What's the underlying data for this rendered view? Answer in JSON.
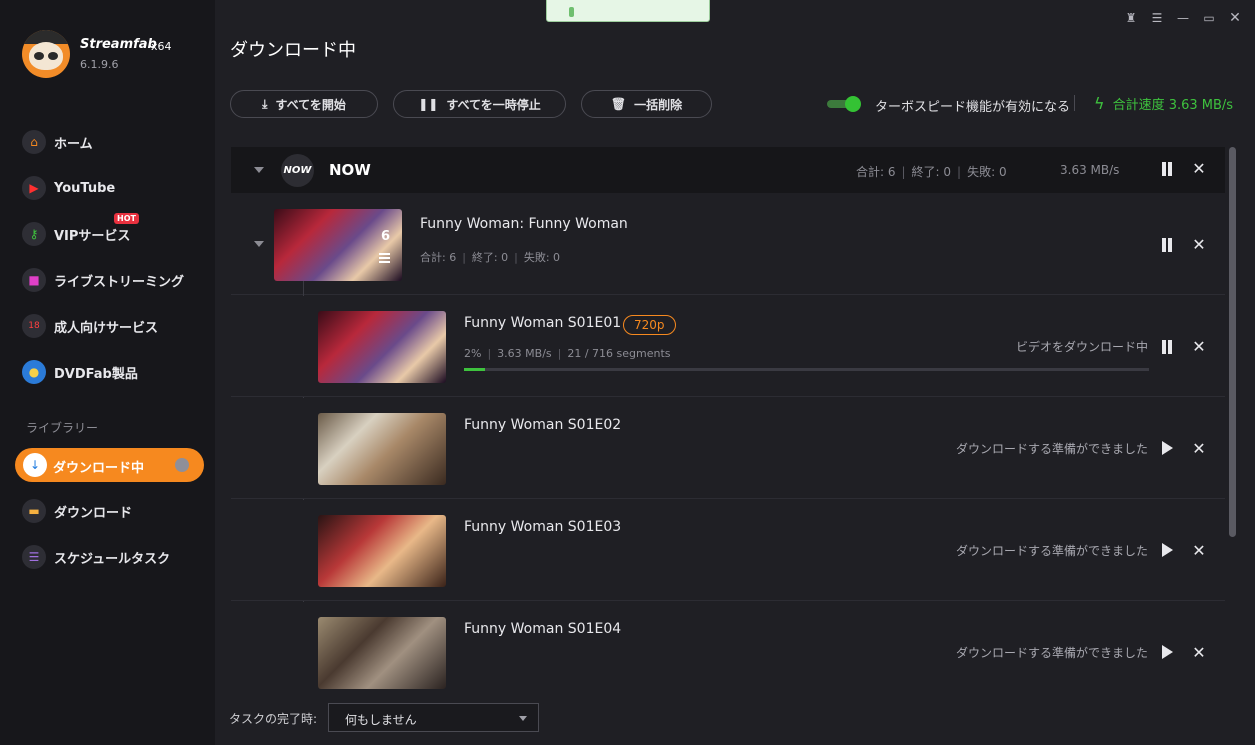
{
  "app": {
    "name": "Streamfab",
    "arch": "x64",
    "version": "6.1.9.6"
  },
  "sidebar": {
    "items": [
      {
        "label": "ホーム",
        "icon": "home-icon"
      },
      {
        "label": "YouTube",
        "icon": "youtube-icon"
      },
      {
        "label": "VIPサービス",
        "icon": "key-icon",
        "badge": "HOT"
      },
      {
        "label": "ライブストリーミング",
        "icon": "camera-icon"
      },
      {
        "label": "成人向けサービス",
        "icon": "adult-icon"
      },
      {
        "label": "DVDFab製品",
        "icon": "dvdfab-icon"
      }
    ],
    "library_title": "ライブラリー",
    "library": [
      {
        "label": "ダウンロード中",
        "icon": "download-icon",
        "active": true
      },
      {
        "label": "ダウンロード",
        "icon": "folder-icon"
      },
      {
        "label": "スケジュールタスク",
        "icon": "schedule-icon"
      }
    ]
  },
  "header": {
    "title": "ダウンロード中",
    "buttons": {
      "start_all": "すべてを開始",
      "pause_all": "すべてを一時停止",
      "delete_all": "一括削除"
    },
    "turbo_label": "ターボスピード機能が有効になる",
    "turbo_on": true,
    "speed_total": "合計速度 3.63 MB/s"
  },
  "group": {
    "name": "NOW",
    "logo_text": "NOW",
    "total": "合計: 6",
    "done": "終了: 0",
    "failed": "失敗: 0",
    "speed": "3.63 MB/s"
  },
  "series": {
    "title": "Funny Woman: Funny Woman",
    "count": "6",
    "total": "合計: 6",
    "done": "終了: 0",
    "failed": "失敗: 0"
  },
  "episodes": [
    {
      "title": "Funny Woman S01E01",
      "resolution": "720p",
      "percent": "2%",
      "speed": "3.63 MB/s",
      "segments": "21 / 716 segments",
      "progress": 0.02,
      "status": "ビデオをダウンロード中"
    },
    {
      "title": "Funny Woman S01E02",
      "status": "ダウンロードする準備ができました"
    },
    {
      "title": "Funny Woman S01E03",
      "status": "ダウンロードする準備ができました"
    },
    {
      "title": "Funny Woman S01E04",
      "status": "ダウンロードする準備ができました"
    }
  ],
  "footer": {
    "label": "タスクの完了時:",
    "select_value": "何もしません"
  },
  "colors": {
    "accent": "#f6891f",
    "speed_green": "#3ec23e",
    "badge_red": "#e8313f"
  }
}
